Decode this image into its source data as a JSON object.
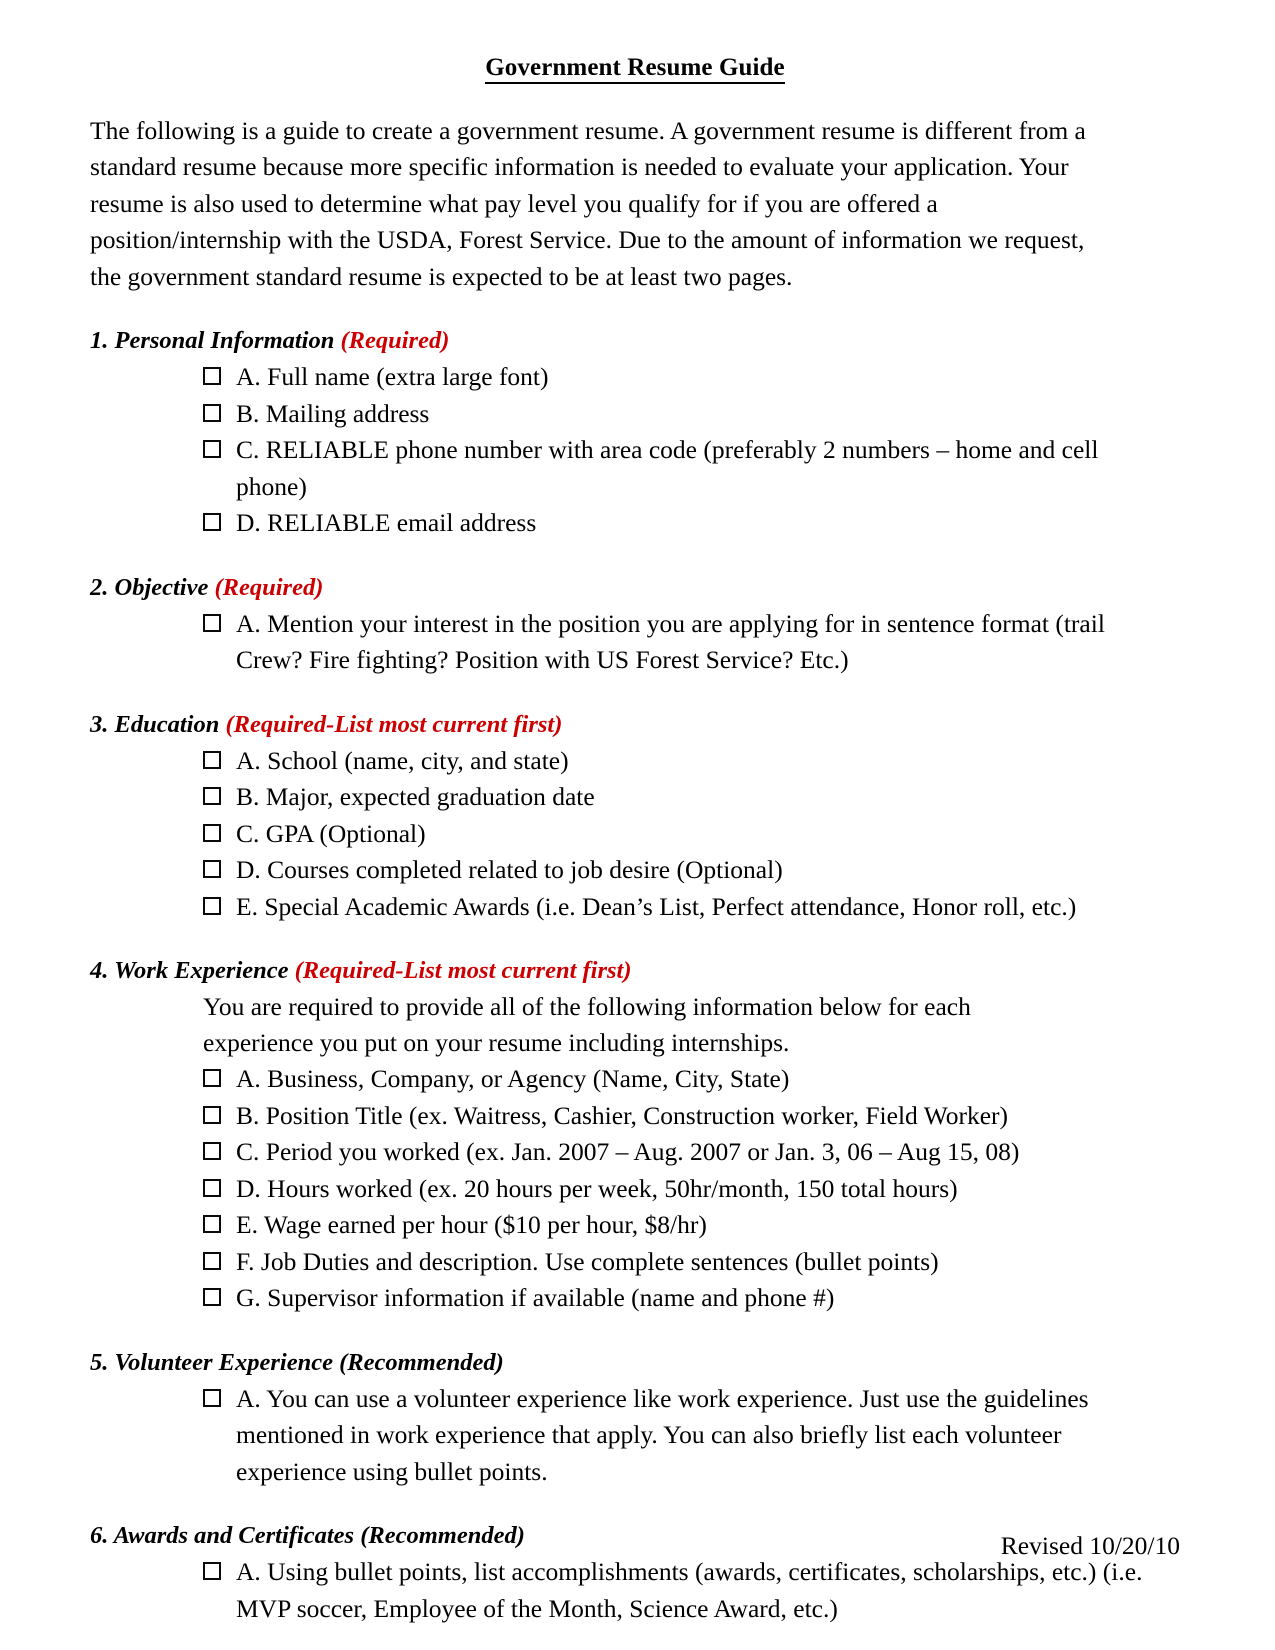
{
  "document": {
    "title": "Government Resume Guide",
    "intro": "The following is a guide to create a government resume. A government resume is different from a standard resume because more specific information is needed to evaluate your application. Your resume is also used to determine what pay level you qualify for if you are offered a position/internship with the USDA, Forest Service. Due to the amount of information we request, the government standard resume is expected to be at least two pages.",
    "footer": "Revised 10/20/10",
    "accent_red": "#CC0000"
  },
  "sections": [
    {
      "number": "1.",
      "name": "Personal Information",
      "qualifier": "(Required)",
      "qualifier_color": "red",
      "note": "",
      "items": [
        "A. Full name (extra large font)",
        "B. Mailing address",
        "C. RELIABLE phone number with area code (preferably 2 numbers – home and cell phone)",
        "D. RELIABLE email address"
      ]
    },
    {
      "number": "2.",
      "name": "Objective",
      "qualifier": "(Required)",
      "qualifier_color": "red",
      "note": "",
      "items": [
        "A. Mention your interest in the position you are applying for in sentence format (trail Crew? Fire fighting? Position with US Forest Service? Etc.)"
      ]
    },
    {
      "number": "3.",
      "name": "Education",
      "qualifier": "(Required-List most current first)",
      "qualifier_color": "red",
      "note": "",
      "items": [
        "A. School (name, city, and state)",
        "B. Major, expected graduation date",
        "C. GPA (Optional)",
        "D. Courses completed related to job desire (Optional)",
        "E. Special Academic Awards (i.e. Dean’s List, Perfect attendance, Honor roll, etc.)"
      ]
    },
    {
      "number": "4.",
      "name": "Work Experience",
      "qualifier": "(Required-List most current first)",
      "qualifier_color": "red",
      "note": "You are required to provide all of the following information below for each experience you put on your resume including internships.",
      "items": [
        "A. Business, Company, or Agency (Name, City, State)",
        "B. Position Title (ex. Waitress, Cashier, Construction worker, Field Worker)",
        "C. Period you worked (ex. Jan. 2007 – Aug. 2007 or Jan. 3, 06 – Aug 15, 08)",
        "D. Hours worked (ex. 20 hours per week, 50hr/month, 150 total hours)",
        "E. Wage earned per hour ($10 per hour, $8/hr)",
        "F. Job Duties and description. Use complete sentences (bullet points)",
        "G. Supervisor information if available (name and phone #)"
      ]
    },
    {
      "number": "5.",
      "name": "Volunteer Experience",
      "qualifier": "(Recommended)",
      "qualifier_color": "black",
      "note": "",
      "items": [
        "A. You can use a volunteer experience like work experience. Just use the guidelines mentioned in work experience that apply. You can also briefly list each volunteer experience using bullet points."
      ]
    },
    {
      "number": "6.",
      "name": "Awards and Certificates",
      "qualifier": "(Recommended)",
      "qualifier_color": "black",
      "note": "",
      "items": [
        "A. Using bullet points, list accomplishments (awards, certificates, scholarships, etc.) (i.e. MVP soccer, Employee of the Month, Science Award, etc.)"
      ]
    }
  ]
}
